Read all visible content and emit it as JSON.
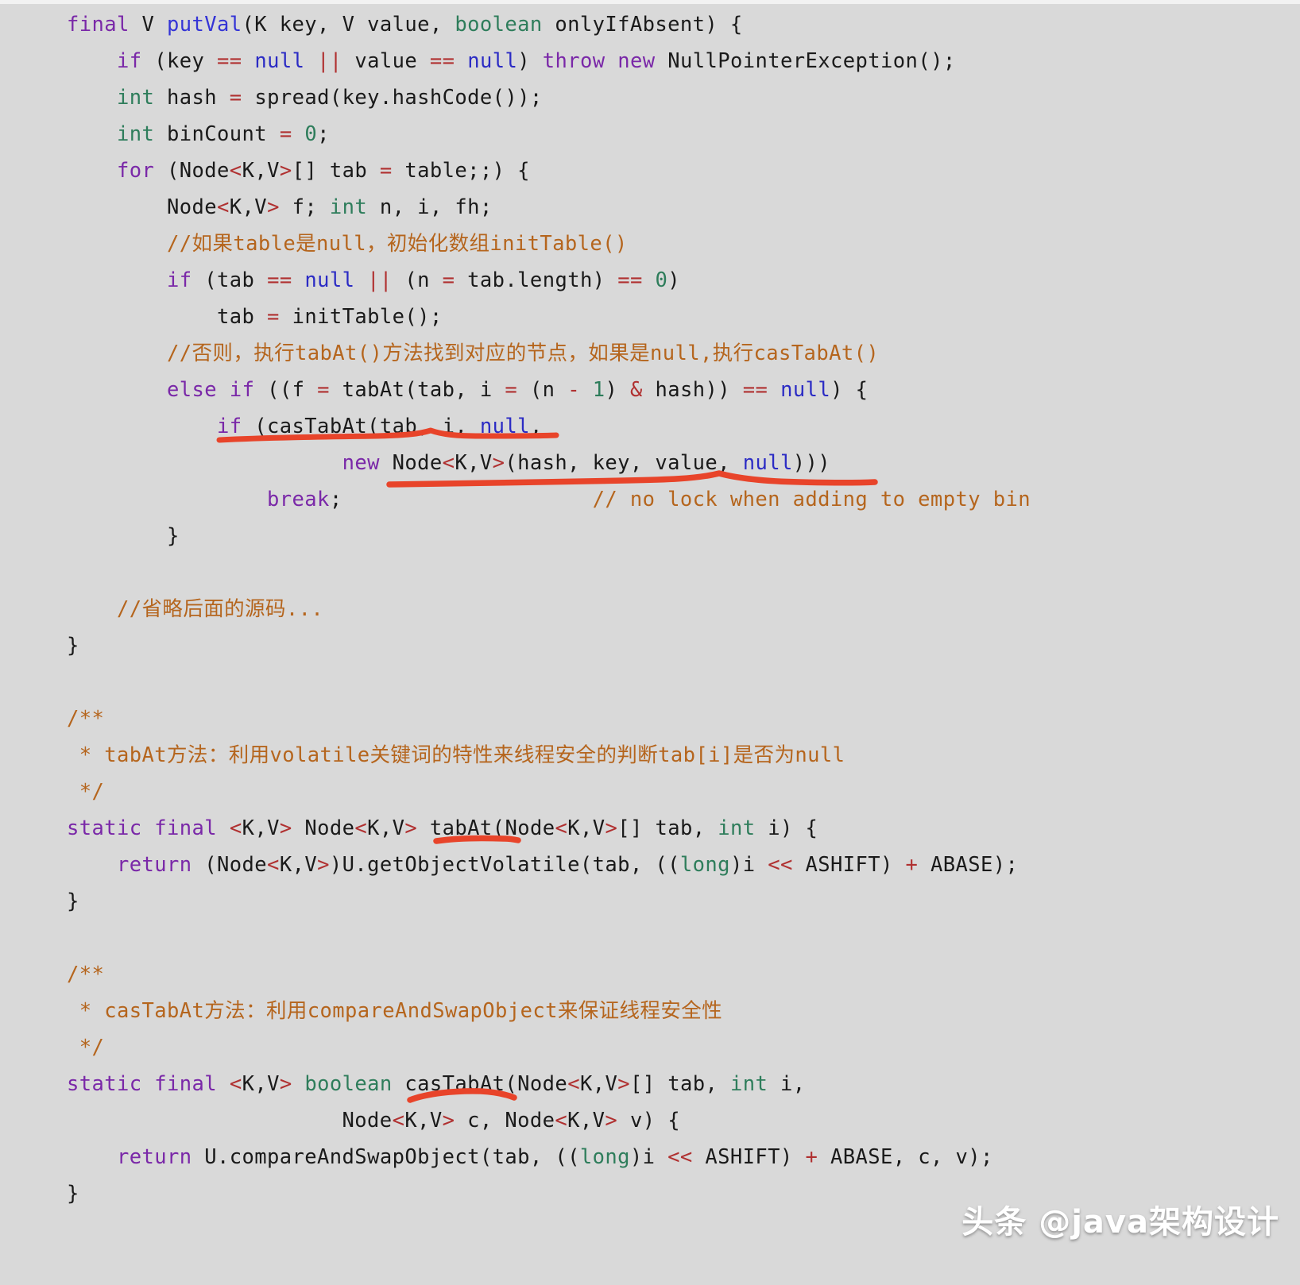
{
  "editor": {
    "background_color": "#d9d9d9",
    "language": "Java",
    "file_subject": "ConcurrentHashMap.putVal / tabAt / casTabAt"
  },
  "colors": {
    "keyword": "#7a28a8",
    "type": "#2e7d5b",
    "method": "#3434d6",
    "null_literal": "#2b2bc4",
    "operator": "#b03030",
    "comment": "#b5651d",
    "marker_red": "#e8442a",
    "text": "#1a1a1a",
    "background": "#d9d9d9"
  },
  "code": {
    "lines": [
      "final V putVal(K key, V value, boolean onlyIfAbsent) {",
      "    if (key == null || value == null) throw new NullPointerException();",
      "    int hash = spread(key.hashCode());",
      "    int binCount = 0;",
      "    for (Node<K,V>[] tab = table;;) {",
      "        Node<K,V> f; int n, i, fh;",
      "        //如果table是null，初始化数组initTable()",
      "        if (tab == null || (n = tab.length) == 0)",
      "            tab = initTable();",
      "        //否则，执行tabAt()方法找到对应的节点，如果是null,执行casTabAt()",
      "        else if ((f = tabAt(tab, i = (n - 1) & hash)) == null) {",
      "            if (casTabAt(tab, i, null,",
      "                      new Node<K,V>(hash, key, value, null)))",
      "                break;                    // no lock when adding to empty bin",
      "        }",
      "",
      "    //省略后面的源码...",
      "}",
      "",
      "/**",
      " * tabAt方法：利用volatile关键词的特性来线程安全的判断tab[i]是否为null",
      " */",
      "static final <K,V> Node<K,V> tabAt(Node<K,V>[] tab, int i) {",
      "    return (Node<K,V>)U.getObjectVolatile(tab, ((long)i << ASHIFT) + ABASE);",
      "}",
      "",
      "/**",
      " * casTabAt方法：利用compareAndSwapObject来保证线程安全性",
      " */",
      "static final <K,V> boolean casTabAt(Node<K,V>[] tab, int i,",
      "                      Node<K,V> c, Node<K,V> v) {",
      "    return U.compareAndSwapObject(tab, ((long)i << ASHIFT) + ABASE, c, v);",
      "}"
    ]
  },
  "annotations": {
    "marker_color": "#e8442a",
    "underlines": [
      {
        "label": "if-casTabAt-null-underline",
        "target": "if (casTabAt(tab, i, null,"
      },
      {
        "label": "new-node-underline",
        "target": "new Node<K,V>(hash, key, value, null)))"
      },
      {
        "label": "tabAt-name-underline",
        "target": "tabAt"
      },
      {
        "label": "casTabAt-name-underline",
        "target": "casTabAt"
      }
    ]
  },
  "watermark": {
    "text": "头条 @java架构设计"
  }
}
